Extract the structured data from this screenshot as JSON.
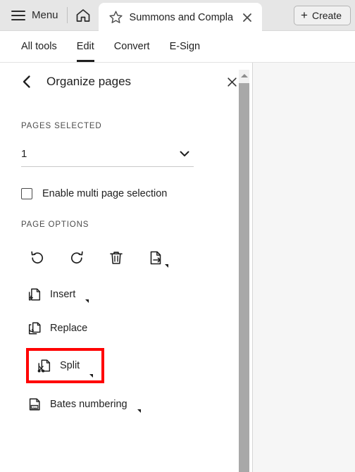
{
  "window": {
    "menu_label": "Menu",
    "home_icon": "home-icon",
    "hamburger_icon": "hamburger-icon"
  },
  "tab": {
    "star_icon": "star-outline-icon",
    "title": "Summons and Complai...",
    "close_icon": "close-icon"
  },
  "create_button": {
    "plus": "+",
    "label": "Create"
  },
  "tool_tabs": [
    {
      "label": "All tools",
      "active": false
    },
    {
      "label": "Edit",
      "active": true
    },
    {
      "label": "Convert",
      "active": false
    },
    {
      "label": "E-Sign",
      "active": false
    }
  ],
  "panel": {
    "back_icon": "chevron-left-icon",
    "title": "Organize pages",
    "close_icon": "close-icon",
    "pages_selected_label": "PAGES SELECTED",
    "pages_selected_value": "1",
    "pages_selected_chevron": "chevron-down-icon",
    "multi_select_label": "Enable multi page selection",
    "multi_select_checked": false,
    "page_options_label": "PAGE OPTIONS",
    "icon_actions": [
      {
        "name": "rotate-counterclockwise-icon",
        "has_caret": false
      },
      {
        "name": "rotate-clockwise-icon",
        "has_caret": false
      },
      {
        "name": "delete-trash-icon",
        "has_caret": false
      },
      {
        "name": "extract-pages-icon",
        "has_caret": true
      }
    ],
    "options": [
      {
        "label": "Insert",
        "icon": "insert-page-icon",
        "caret": true,
        "highlighted": false
      },
      {
        "label": "Replace",
        "icon": "replace-page-icon",
        "caret": false,
        "highlighted": false
      },
      {
        "label": "Split",
        "icon": "split-page-icon",
        "caret": true,
        "highlighted": true
      },
      {
        "label": "Bates numbering",
        "icon": "bates-numbering-icon",
        "caret": true,
        "highlighted": false
      }
    ]
  },
  "colors": {
    "highlight": "#ff0000",
    "topbar_bg": "#e6e6e6",
    "panel_bg": "#ffffff",
    "doc_bg": "#f6f6f6",
    "text": "#1f1f1f",
    "scroll_thumb": "#a8a8a8"
  }
}
